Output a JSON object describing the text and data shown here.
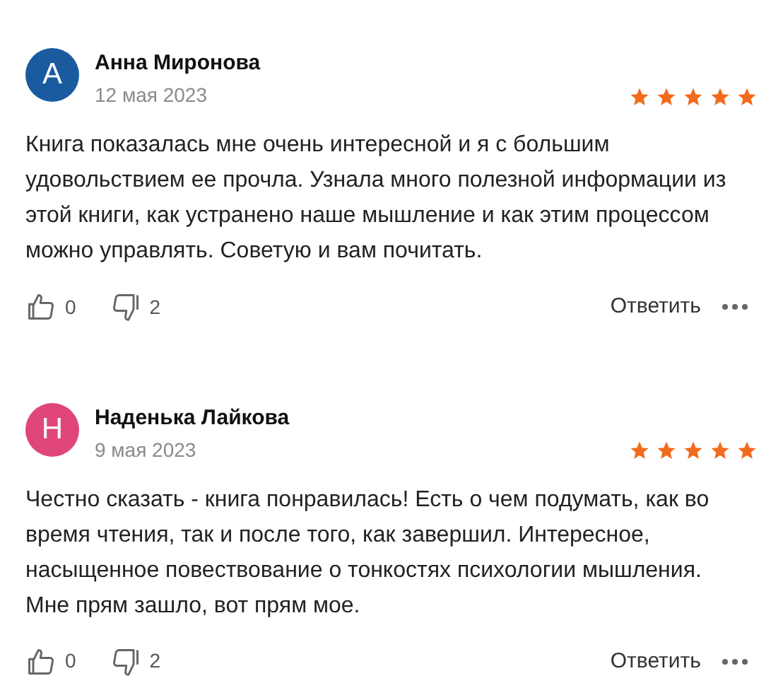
{
  "reviews": [
    {
      "avatar_letter": "А",
      "color": "#1a5a9e",
      "name": "Анна Миронова",
      "date": "12 мая 2023",
      "stars": 5,
      "text": "Книга показалась мне очень интересной и я с большим удовольствием ее прочла. Узнала много полезной информации из этой книги, как устранено наше мышление и как этим процессом можно управлять. Советую и вам почитать.",
      "likes": "0",
      "dislikes": "2",
      "reply": "Ответить"
    },
    {
      "avatar_letter": "Н",
      "color": "#e0457b",
      "name": "Наденька Лайкова",
      "date": "9 мая 2023",
      "stars": 5,
      "text": "Честно сказать - книга понравилась! Есть о чем подумать, как во время чтения, так и после того, как завершил. Интересное, насыщенное повествование о тонкостях психологии мышления. Мне прям зашло, вот прям мое.",
      "likes": "0",
      "dislikes": "2",
      "reply": "Ответить"
    }
  ]
}
